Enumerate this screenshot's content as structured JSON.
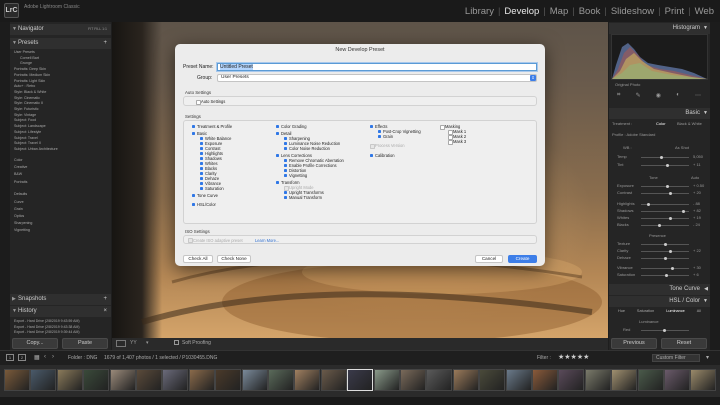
{
  "app": {
    "logo": "LrC",
    "title": "Adobe Lightroom Classic",
    "modules": [
      "Library",
      "Develop",
      "Map",
      "Book",
      "Slideshow",
      "Print",
      "Web"
    ],
    "active_module": "Develop"
  },
  "left_panel": {
    "navigator": "Navigator",
    "navigator_zoom": "FIT  FILL  1:1",
    "presets_header": "Presets",
    "presets": [
      {
        "label": "User Presets",
        "sub": false
      },
      {
        "label": "Cornell Bart",
        "sub": true
      },
      {
        "label": "Grunge",
        "sub": true
      },
      {
        "label": "Portraits: Deep Skin",
        "sub": false
      },
      {
        "label": "Portraits: Medium Skin",
        "sub": false
      },
      {
        "label": "Portraits: Light Skin",
        "sub": false
      },
      {
        "label": "Auto+ : Retro",
        "sub": false
      },
      {
        "label": "Style: Black & White",
        "sub": false
      },
      {
        "label": "Style: Cinematic",
        "sub": false
      },
      {
        "label": "Style: Cinematic II",
        "sub": false
      },
      {
        "label": "Style: Futuristic",
        "sub": false
      },
      {
        "label": "Style: Vintage",
        "sub": false
      },
      {
        "label": "Subject: Food",
        "sub": false
      },
      {
        "label": "Subject: Landscape",
        "sub": false
      },
      {
        "label": "Subject: Lifestyle",
        "sub": false
      },
      {
        "label": "Subject: Travel",
        "sub": false
      },
      {
        "label": "Subject: Travel II",
        "sub": false
      },
      {
        "label": "Subject: Urban Architecture",
        "sub": false
      }
    ],
    "presets_more": [
      "Color",
      "Creative",
      "B&W",
      "Portraits",
      "Defaults",
      "Curve",
      "Grain",
      "Optics",
      "Sharpening",
      "Vignetting"
    ],
    "snapshots_header": "Snapshots",
    "history_header": "History",
    "history": [
      "Export - Hard Drive (2/8/2019 9:43:59 AM)",
      "Export - Hard Drive (2/8/2019 9:43:38 AM)",
      "Export - Hard Drive (2/8/2019 9:39:44 AM)"
    ],
    "copy_label": "Copy...",
    "paste_label": "Paste"
  },
  "right_panel": {
    "histogram": "Histogram",
    "original_photo": "Original Photo",
    "basic": "Basic",
    "treatment": "Treatment :",
    "treatment_color": "Color",
    "treatment_bw": "Black & White",
    "profile": "Profile : Adobe Standard",
    "wb": "WB :",
    "wb_value": "As Shot",
    "temp": "Temp",
    "tint": "Tint",
    "temp_val": "5,050",
    "tint_val": "+ 11",
    "tone": "Tone",
    "auto": "Auto",
    "exposure": "Exposure",
    "contrast": "Contrast",
    "highlights": "Highlights",
    "shadows": "Shadows",
    "whites": "Whites",
    "blacks": "Blacks",
    "exposure_val": "+ 0.50",
    "contrast_val": "+ 20",
    "highlights_val": "- 88",
    "shadows_val": "+ 82",
    "whites_val": "+ 19",
    "blacks_val": "- 24",
    "presence": "Presence",
    "texture": "Texture",
    "clarity": "Clarity",
    "dehaze": "Dehaze",
    "vibrance": "Vibrance",
    "saturation": "Saturation",
    "clarity_val": "+ 22",
    "vibrance_val": "+ 30",
    "saturation_val": "+ 6",
    "tone_curve": "Tone Curve",
    "hsl": "HSL / Color",
    "hsl_tabs": [
      "Hue",
      "Saturation",
      "Luminance",
      "All"
    ],
    "luminance": "Luminance",
    "red": "Red",
    "previous_label": "Previous",
    "reset_label": "Reset"
  },
  "toolbar": {
    "soft_proofing": "Soft Proofing"
  },
  "filmbar": {
    "folder": "Folder : DNG",
    "count": "1679 of 1,407 photos / 1 selected / P1030455.DNG",
    "filter_label": "Filter :",
    "stars": "★★★★★",
    "custom_filter": "Custom Filter"
  },
  "dialog": {
    "title": "New Develop Preset",
    "preset_name_label": "Preset Name:",
    "preset_name_value": "Untitled Preset",
    "group_label": "Group:",
    "group_value": "User Presets",
    "auto_settings_title": "Auto Settings",
    "auto_settings_cb": "Auto Settings",
    "settings_title": "Settings",
    "col1": [
      "Treatment & Profile",
      "Basic",
      "White Balance",
      "Exposure",
      "Contrast",
      "Highlights",
      "Shadows",
      "Whites",
      "Blacks",
      "Clarity",
      "Dehaze",
      "Vibrance",
      "Saturation",
      "Tone Curve",
      "HSL/Color"
    ],
    "col2": [
      "Color Grading",
      "Detail",
      "Sharpening",
      "Luminance Noise Reduction",
      "Color Noise Reduction",
      "Lens Corrections",
      "Remove Chromatic Aberration",
      "Enable Profile Corrections",
      "Distortion",
      "Vignetting",
      "Transform",
      "Upright Mode",
      "Upright Transforms",
      "Manual Transform"
    ],
    "col3": [
      "Effects",
      "Post-Crop Vignetting",
      "Grain",
      "Process Version",
      "Calibration"
    ],
    "col4": [
      "Masking",
      "Mask 1",
      "Mask 2",
      "Mask 3"
    ],
    "iso_title": "ISO Settings",
    "iso_cb": "Create ISO adaptive preset",
    "learn_more": "Learn More...",
    "check_all": "Check All",
    "check_none": "Check None",
    "cancel": "Cancel",
    "create": "Create"
  }
}
